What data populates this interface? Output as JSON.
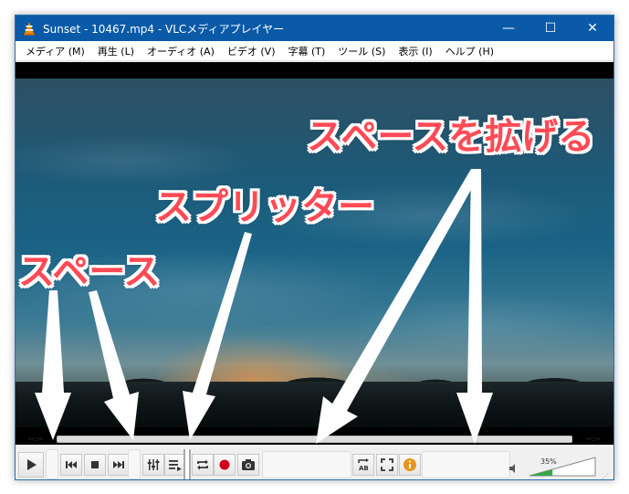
{
  "window": {
    "title": "Sunset - 10467.mp4 - VLCメディアプレイヤー",
    "minimize": "—",
    "maximize": "☐",
    "close": "✕"
  },
  "menu": [
    {
      "label": "メディア (M)"
    },
    {
      "label": "再生 (L)"
    },
    {
      "label": "オーディオ (A)"
    },
    {
      "label": "ビデオ (V)"
    },
    {
      "label": "字幕 (T)"
    },
    {
      "label": "ツール (S)"
    },
    {
      "label": "表示 (I)"
    },
    {
      "label": "ヘルプ (H)"
    }
  ],
  "annotations": {
    "space": "スペース",
    "splitter": "スプリッター",
    "expand_space": "スペースを拡げる"
  },
  "seek": {
    "elapsed": "--:--",
    "remaining": "--:--"
  },
  "controls": {
    "buttons": [
      "play-icon",
      "previous-icon",
      "stop-icon",
      "next-icon",
      "equalizer-icon",
      "playlist-icon",
      "loop-icon",
      "record-icon",
      "snapshot-icon",
      "ab-loop-icon",
      "fullscreen-icon",
      "info-icon"
    ],
    "volume_percent": "35%",
    "volume_level": 0.35
  },
  "colors": {
    "titlebar": "#0a5aa8",
    "annotation": "#ff4a55",
    "record": "#d0021b",
    "info": "#e8941a",
    "volume_fill": "#3aa64a"
  }
}
